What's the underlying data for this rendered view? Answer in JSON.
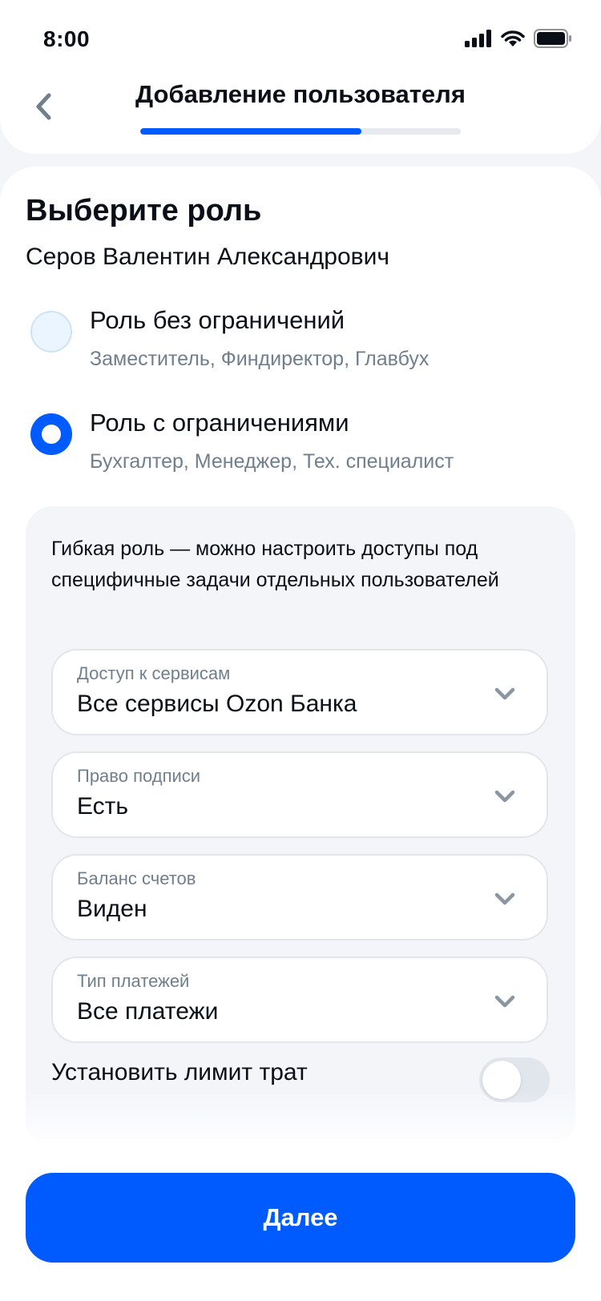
{
  "status_bar": {
    "time": "8:00"
  },
  "header": {
    "title": "Добавление пользователя",
    "progress_percent": 69
  },
  "main": {
    "title": "Выберите роль",
    "user_name": "Серов Валентин Александрович",
    "roles": [
      {
        "title": "Роль без ограничений",
        "subtitle": "Заместитель, Финдиректор, Главбух",
        "selected": false
      },
      {
        "title": "Роль с ограничениями",
        "subtitle": "Бухгалтер, Менеджер, Тех. специалист",
        "selected": true
      }
    ],
    "panel": {
      "description": "Гибкая роль — можно настроить доступы под специфичные задачи отдельных пользователей",
      "fields": [
        {
          "label": "Доступ к сервисам",
          "value": "Все сервисы Ozon Банка"
        },
        {
          "label": "Право подписи",
          "value": "Есть"
        },
        {
          "label": "Баланс счетов",
          "value": "Виден"
        },
        {
          "label": "Тип платежей",
          "value": "Все платежи"
        }
      ],
      "spending_limit": {
        "label": "Установить лимит трат",
        "enabled": false
      }
    }
  },
  "footer": {
    "next_label": "Далее"
  },
  "colors": {
    "accent": "#005BFF",
    "text": "#0A0E17",
    "secondary": "#707F8D",
    "panel": "#F3F5F9"
  }
}
